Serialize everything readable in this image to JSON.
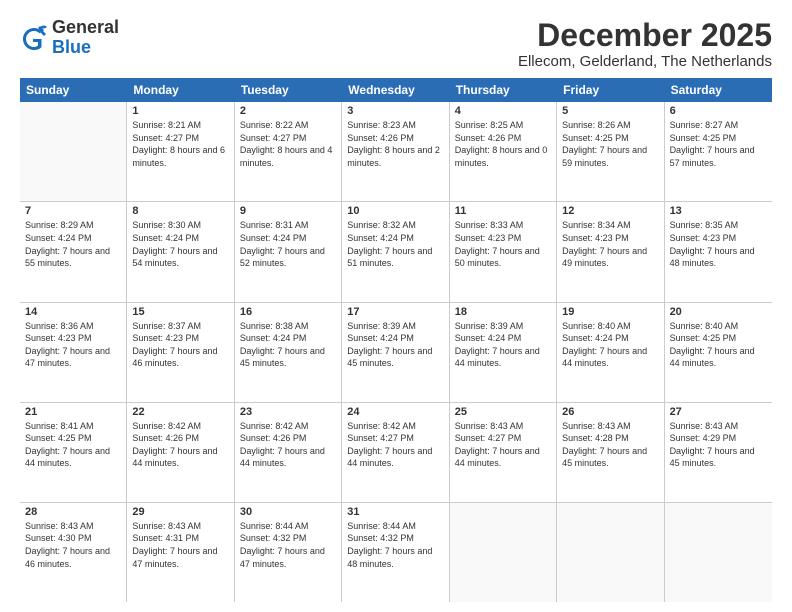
{
  "logo": {
    "general": "General",
    "blue": "Blue"
  },
  "title": {
    "month": "December 2025",
    "location": "Ellecom, Gelderland, The Netherlands"
  },
  "weekdays": [
    "Sunday",
    "Monday",
    "Tuesday",
    "Wednesday",
    "Thursday",
    "Friday",
    "Saturday"
  ],
  "weeks": [
    [
      {
        "day": "",
        "sunrise": "",
        "sunset": "",
        "daylight": ""
      },
      {
        "day": "1",
        "sunrise": "Sunrise: 8:21 AM",
        "sunset": "Sunset: 4:27 PM",
        "daylight": "Daylight: 8 hours and 6 minutes."
      },
      {
        "day": "2",
        "sunrise": "Sunrise: 8:22 AM",
        "sunset": "Sunset: 4:27 PM",
        "daylight": "Daylight: 8 hours and 4 minutes."
      },
      {
        "day": "3",
        "sunrise": "Sunrise: 8:23 AM",
        "sunset": "Sunset: 4:26 PM",
        "daylight": "Daylight: 8 hours and 2 minutes."
      },
      {
        "day": "4",
        "sunrise": "Sunrise: 8:25 AM",
        "sunset": "Sunset: 4:26 PM",
        "daylight": "Daylight: 8 hours and 0 minutes."
      },
      {
        "day": "5",
        "sunrise": "Sunrise: 8:26 AM",
        "sunset": "Sunset: 4:25 PM",
        "daylight": "Daylight: 7 hours and 59 minutes."
      },
      {
        "day": "6",
        "sunrise": "Sunrise: 8:27 AM",
        "sunset": "Sunset: 4:25 PM",
        "daylight": "Daylight: 7 hours and 57 minutes."
      }
    ],
    [
      {
        "day": "7",
        "sunrise": "Sunrise: 8:29 AM",
        "sunset": "Sunset: 4:24 PM",
        "daylight": "Daylight: 7 hours and 55 minutes."
      },
      {
        "day": "8",
        "sunrise": "Sunrise: 8:30 AM",
        "sunset": "Sunset: 4:24 PM",
        "daylight": "Daylight: 7 hours and 54 minutes."
      },
      {
        "day": "9",
        "sunrise": "Sunrise: 8:31 AM",
        "sunset": "Sunset: 4:24 PM",
        "daylight": "Daylight: 7 hours and 52 minutes."
      },
      {
        "day": "10",
        "sunrise": "Sunrise: 8:32 AM",
        "sunset": "Sunset: 4:24 PM",
        "daylight": "Daylight: 7 hours and 51 minutes."
      },
      {
        "day": "11",
        "sunrise": "Sunrise: 8:33 AM",
        "sunset": "Sunset: 4:23 PM",
        "daylight": "Daylight: 7 hours and 50 minutes."
      },
      {
        "day": "12",
        "sunrise": "Sunrise: 8:34 AM",
        "sunset": "Sunset: 4:23 PM",
        "daylight": "Daylight: 7 hours and 49 minutes."
      },
      {
        "day": "13",
        "sunrise": "Sunrise: 8:35 AM",
        "sunset": "Sunset: 4:23 PM",
        "daylight": "Daylight: 7 hours and 48 minutes."
      }
    ],
    [
      {
        "day": "14",
        "sunrise": "Sunrise: 8:36 AM",
        "sunset": "Sunset: 4:23 PM",
        "daylight": "Daylight: 7 hours and 47 minutes."
      },
      {
        "day": "15",
        "sunrise": "Sunrise: 8:37 AM",
        "sunset": "Sunset: 4:23 PM",
        "daylight": "Daylight: 7 hours and 46 minutes."
      },
      {
        "day": "16",
        "sunrise": "Sunrise: 8:38 AM",
        "sunset": "Sunset: 4:24 PM",
        "daylight": "Daylight: 7 hours and 45 minutes."
      },
      {
        "day": "17",
        "sunrise": "Sunrise: 8:39 AM",
        "sunset": "Sunset: 4:24 PM",
        "daylight": "Daylight: 7 hours and 45 minutes."
      },
      {
        "day": "18",
        "sunrise": "Sunrise: 8:39 AM",
        "sunset": "Sunset: 4:24 PM",
        "daylight": "Daylight: 7 hours and 44 minutes."
      },
      {
        "day": "19",
        "sunrise": "Sunrise: 8:40 AM",
        "sunset": "Sunset: 4:24 PM",
        "daylight": "Daylight: 7 hours and 44 minutes."
      },
      {
        "day": "20",
        "sunrise": "Sunrise: 8:40 AM",
        "sunset": "Sunset: 4:25 PM",
        "daylight": "Daylight: 7 hours and 44 minutes."
      }
    ],
    [
      {
        "day": "21",
        "sunrise": "Sunrise: 8:41 AM",
        "sunset": "Sunset: 4:25 PM",
        "daylight": "Daylight: 7 hours and 44 minutes."
      },
      {
        "day": "22",
        "sunrise": "Sunrise: 8:42 AM",
        "sunset": "Sunset: 4:26 PM",
        "daylight": "Daylight: 7 hours and 44 minutes."
      },
      {
        "day": "23",
        "sunrise": "Sunrise: 8:42 AM",
        "sunset": "Sunset: 4:26 PM",
        "daylight": "Daylight: 7 hours and 44 minutes."
      },
      {
        "day": "24",
        "sunrise": "Sunrise: 8:42 AM",
        "sunset": "Sunset: 4:27 PM",
        "daylight": "Daylight: 7 hours and 44 minutes."
      },
      {
        "day": "25",
        "sunrise": "Sunrise: 8:43 AM",
        "sunset": "Sunset: 4:27 PM",
        "daylight": "Daylight: 7 hours and 44 minutes."
      },
      {
        "day": "26",
        "sunrise": "Sunrise: 8:43 AM",
        "sunset": "Sunset: 4:28 PM",
        "daylight": "Daylight: 7 hours and 45 minutes."
      },
      {
        "day": "27",
        "sunrise": "Sunrise: 8:43 AM",
        "sunset": "Sunset: 4:29 PM",
        "daylight": "Daylight: 7 hours and 45 minutes."
      }
    ],
    [
      {
        "day": "28",
        "sunrise": "Sunrise: 8:43 AM",
        "sunset": "Sunset: 4:30 PM",
        "daylight": "Daylight: 7 hours and 46 minutes."
      },
      {
        "day": "29",
        "sunrise": "Sunrise: 8:43 AM",
        "sunset": "Sunset: 4:31 PM",
        "daylight": "Daylight: 7 hours and 47 minutes."
      },
      {
        "day": "30",
        "sunrise": "Sunrise: 8:44 AM",
        "sunset": "Sunset: 4:32 PM",
        "daylight": "Daylight: 7 hours and 47 minutes."
      },
      {
        "day": "31",
        "sunrise": "Sunrise: 8:44 AM",
        "sunset": "Sunset: 4:32 PM",
        "daylight": "Daylight: 7 hours and 48 minutes."
      },
      {
        "day": "",
        "sunrise": "",
        "sunset": "",
        "daylight": ""
      },
      {
        "day": "",
        "sunrise": "",
        "sunset": "",
        "daylight": ""
      },
      {
        "day": "",
        "sunrise": "",
        "sunset": "",
        "daylight": ""
      }
    ]
  ]
}
